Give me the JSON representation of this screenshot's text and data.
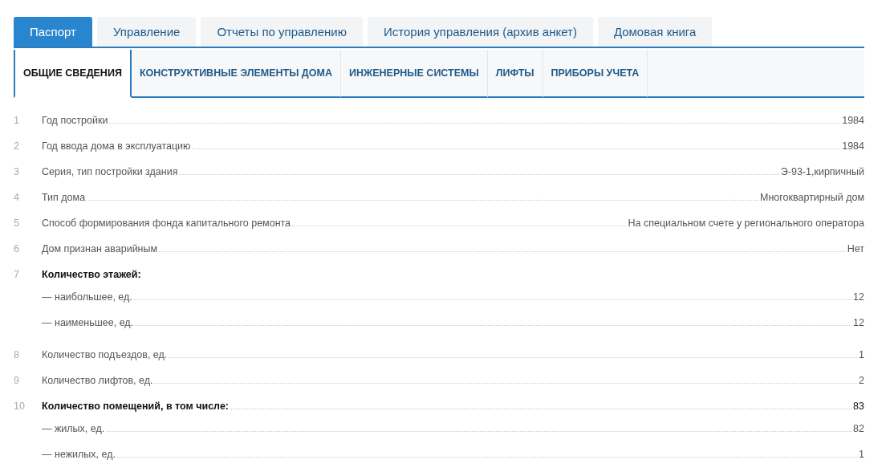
{
  "tabs": [
    {
      "label": "Паспорт",
      "selected": true
    },
    {
      "label": "Управление",
      "selected": false
    },
    {
      "label": "Отчеты по управлению",
      "selected": false
    },
    {
      "label": "История управления (архив анкет)",
      "selected": false
    },
    {
      "label": "Домовая книга",
      "selected": false
    }
  ],
  "subtabs": [
    {
      "label": "ОБЩИЕ СВЕДЕНИЯ",
      "selected": true
    },
    {
      "label": "КОНСТРУКТИВНЫЕ ЭЛЕМЕНТЫ ДОМА",
      "selected": false
    },
    {
      "label": "ИНЖЕНЕРНЫЕ СИСТЕМЫ",
      "selected": false
    },
    {
      "label": "ЛИФТЫ",
      "selected": false
    },
    {
      "label": "ПРИБОРЫ УЧЕТА",
      "selected": false
    }
  ],
  "rows": [
    {
      "kind": "item",
      "number": "1",
      "label": "Год постройки",
      "value": "1984"
    },
    {
      "kind": "item",
      "number": "2",
      "label": "Год ввода дома в эксплуатацию",
      "value": "1984"
    },
    {
      "kind": "item",
      "number": "3",
      "label": "Серия, тип постройки здания",
      "value": "Э-93-1,кирпичный"
    },
    {
      "kind": "item",
      "number": "4",
      "label": "Тип дома",
      "value": "Многоквартирный дом"
    },
    {
      "kind": "item",
      "number": "5",
      "label": "Способ формирования фонда капитального ремонта",
      "value": "На специальном счете у регионального оператора"
    },
    {
      "kind": "item",
      "number": "6",
      "label": "Дом признан аварийным",
      "value": "Нет"
    },
    {
      "kind": "heading",
      "number": "7",
      "label": "Количество этажей:"
    },
    {
      "kind": "sub",
      "label": "— наибольшее, ед.",
      "value": "12"
    },
    {
      "kind": "sub",
      "label": "— наименьшее, ед.",
      "value": "12"
    },
    {
      "kind": "item",
      "number": "8",
      "label": "Количество подъездов, ед.",
      "value": "1"
    },
    {
      "kind": "item",
      "number": "9",
      "label": "Количество лифтов, ед.",
      "value": "2"
    },
    {
      "kind": "heading",
      "number": "10",
      "label": "Количество помещений, в том числе:",
      "value": "83"
    },
    {
      "kind": "sub",
      "label": "— жилых, ед.",
      "value": "82"
    },
    {
      "kind": "sub",
      "label": "— нежилых, ед.",
      "value": "1"
    }
  ]
}
